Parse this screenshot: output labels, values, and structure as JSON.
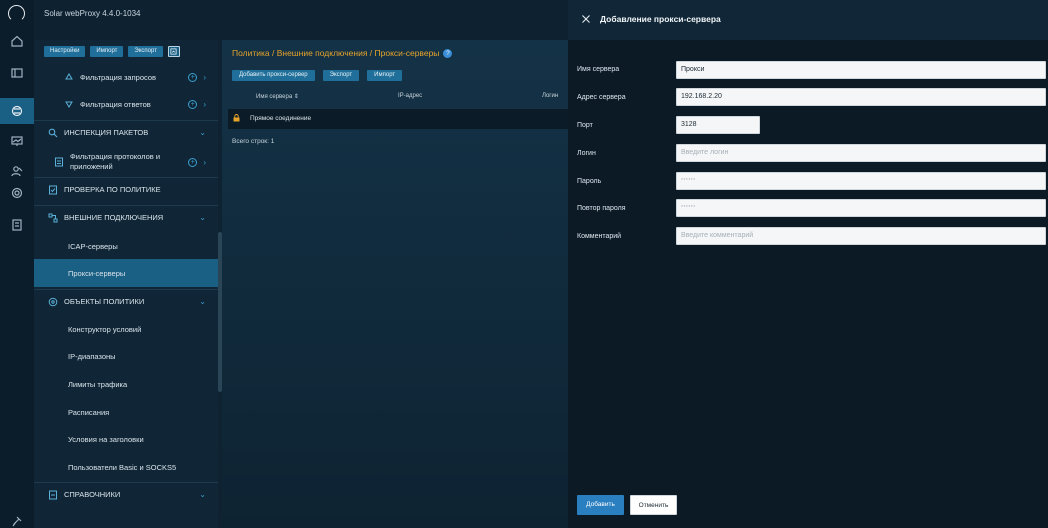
{
  "app": {
    "title": "Solar webProxy   4.4.0-1034"
  },
  "sidebar": {
    "toolbar": {
      "settings": "Настройки",
      "import": "Импорт",
      "export": "Экспорт"
    },
    "items": [
      {
        "label": "Фильтрация запросов"
      },
      {
        "label": "Фильтрация ответов"
      },
      {
        "label": "ИНСПЕКЦИЯ ПАКЕТОВ"
      },
      {
        "label": "Фильтрация протоколов и",
        "label2": "приложений"
      },
      {
        "label": "ПРОВЕРКА ПО ПОЛИТИКЕ"
      },
      {
        "label": "ВНЕШНИЕ ПОДКЛЮЧЕНИЯ"
      },
      {
        "label": "ICAP-серверы"
      },
      {
        "label": "Прокси-серверы"
      },
      {
        "label": "ОБЪЕКТЫ ПОЛИТИКИ"
      },
      {
        "label": "Конструктор условий"
      },
      {
        "label": "IP-диапазоны"
      },
      {
        "label": "Лимиты трафика"
      },
      {
        "label": "Расписания"
      },
      {
        "label": "Условия на заголовки"
      },
      {
        "label": "Пользователи Basic и SOCKS5"
      },
      {
        "label": "СПРАВОЧНИКИ"
      }
    ]
  },
  "main": {
    "breadcrumb": "Политика / Внешние подключения / Прокси-серверы",
    "toolbar": {
      "add": "Добавить прокси-сервер",
      "export": "Экспорт",
      "import": "Импорт"
    },
    "table": {
      "columns": [
        "Имя сервера ⇕",
        "IP-адрес",
        "Логин"
      ],
      "rows": [
        {
          "name": "Прямое соединение"
        }
      ],
      "total": "Всего строк: 1"
    }
  },
  "panel": {
    "title": "Добавление прокси-сервера",
    "fields": {
      "name": {
        "label": "Имя сервера",
        "value": "Прокси"
      },
      "address": {
        "label": "Адрес сервера",
        "value": "192.168.2.20"
      },
      "port": {
        "label": "Порт",
        "value": "3128"
      },
      "login": {
        "label": "Логин",
        "placeholder": "Введите логин"
      },
      "password": {
        "label": "Пароль",
        "placeholder": "******"
      },
      "password_repeat": {
        "label": "Повтор пароля",
        "placeholder": "******"
      },
      "comment": {
        "label": "Комментарий",
        "placeholder": "Введите комментарий"
      }
    },
    "buttons": {
      "add": "Добавить",
      "cancel": "Отменить"
    }
  },
  "colors": {
    "accent": "#1f6f9a",
    "breadcrumb": "#e6a32b",
    "active_nav": "#1a5f84",
    "primary_button": "#2a7fc0"
  }
}
